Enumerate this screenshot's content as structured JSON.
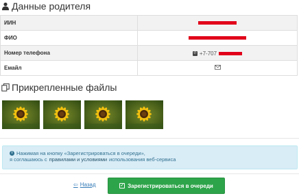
{
  "parent_section": {
    "title": "Данные родителя",
    "icon": "user-icon",
    "rows": [
      {
        "label": "ИИН",
        "value_redacted": true
      },
      {
        "label": "ФИО",
        "value_redacted": true
      },
      {
        "label": "Номер телефона",
        "phone_prefix": "+7-707",
        "value_redacted": true
      },
      {
        "label": "Емайл",
        "icon": "envelope-icon"
      }
    ]
  },
  "files_section": {
    "title": "Прикрепленные файлы",
    "icon": "copy-files-icon",
    "thumbnails": [
      "sunflower-image",
      "sunflower-image",
      "sunflower-image",
      "sunflower-image"
    ]
  },
  "alert": {
    "line1": "Нажимая на кнопку «Зарегистрироваться в очереди»,",
    "line2_prefix": "я соглашаюсь с",
    "line2_link": "правилами и условиями",
    "line2_suffix": "использования веб-сервиса"
  },
  "actions": {
    "back_label": "Назад",
    "register_label": "Зарегистрироваться в очереди"
  },
  "colors": {
    "redaction": "#e1001a",
    "alert_bg": "#d9edf7",
    "alert_text": "#31708f",
    "primary_button": "#2ea44a",
    "link": "#337ab7"
  }
}
